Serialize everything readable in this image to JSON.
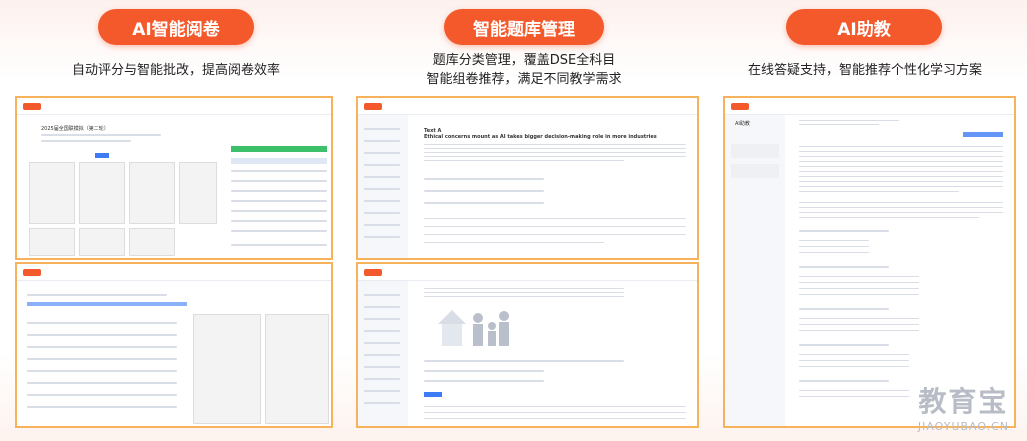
{
  "sections": [
    {
      "title": "AI智能阅卷",
      "subtitle": [
        "自动评分与智能批改，提高阅卷效率"
      ]
    },
    {
      "title": "智能题库管理",
      "subtitle": [
        "题库分类管理，覆盖DSE全科目",
        "智能组卷推荐，满足不同教学需求"
      ]
    },
    {
      "title": "AI助教",
      "subtitle": [
        "在线答疑支持，智能推荐个性化学习方案"
      ]
    }
  ],
  "screens": {
    "grading_top_title": "2025届全国联模拟（第二轮）",
    "question_text_heading": "Text A",
    "question_text_title": "Ethical concerns mount as AI takes bigger decision-making role in more industries",
    "assistant_label": "AI助教"
  },
  "watermark": {
    "cn": "教育宝",
    "en": "JIAOYUBAO.CN"
  },
  "colors": {
    "accent": "#f4592b",
    "frame": "#f6b35b"
  }
}
